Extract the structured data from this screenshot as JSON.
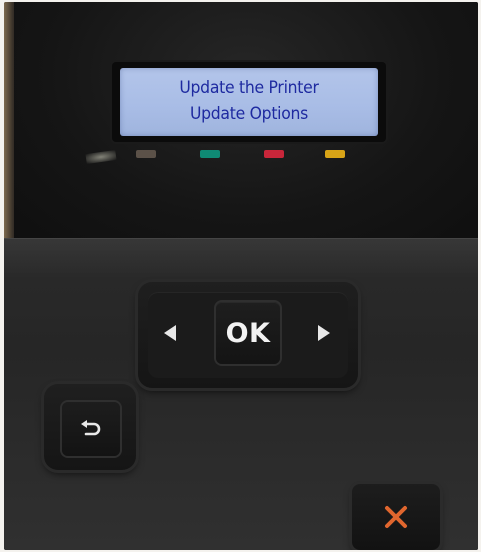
{
  "display": {
    "line1": "Update the Printer",
    "line2": "Update Options"
  },
  "buttons": {
    "ok_label": "OK",
    "left_icon": "left-arrow-icon",
    "right_icon": "right-arrow-icon",
    "back_icon": "back-icon",
    "cancel_icon": "cancel-x-icon"
  },
  "cartridge_lights": [
    {
      "name": "black",
      "color": "#5b5148"
    },
    {
      "name": "cyan",
      "color": "#0f8a74"
    },
    {
      "name": "magenta",
      "color": "#c8263a"
    },
    {
      "name": "yellow",
      "color": "#d8a417"
    }
  ],
  "colors": {
    "lcd_text": "#1e2aa0",
    "lcd_background": "#aabde6",
    "cancel_icon": "#e0662e",
    "panel": "#262626"
  }
}
